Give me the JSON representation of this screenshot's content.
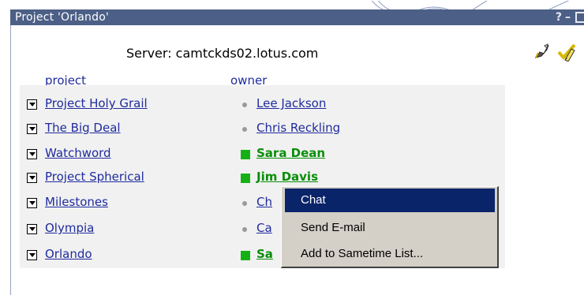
{
  "window": {
    "title": "Project 'Orlando'",
    "controls": [
      "?",
      "–"
    ]
  },
  "header": {
    "server_text": "Server: camtckds02.lotus.com",
    "icons": [
      "rocket-icon",
      "check-pencil-icon"
    ]
  },
  "columns": {
    "project": "project",
    "owner": "owner"
  },
  "rows": [
    {
      "project": "Project Holy Grail",
      "owner": "Lee Jackson",
      "status": "idle"
    },
    {
      "project": "The Big Deal",
      "owner": "Chris Reckling",
      "status": "idle"
    },
    {
      "project": "Watchword",
      "owner": "Sara Dean",
      "status": "active"
    },
    {
      "project": "Project Spherical",
      "owner": "Jim Davis",
      "status": "active"
    },
    {
      "project": "Milestones",
      "owner": "Ch",
      "status": "idle"
    },
    {
      "project": "Olympia",
      "owner": "Ca",
      "status": "idle"
    },
    {
      "project": "Orlando",
      "owner": "Sa",
      "status": "active"
    }
  ],
  "context_menu": {
    "items": [
      "Chat",
      "Send E-mail",
      "Add to Sametime List..."
    ],
    "selected": "Chat"
  },
  "colors": {
    "title_bar": "#4c5f86",
    "link": "#1f2b9e",
    "online": "#14b114",
    "menu_highlight": "#0a246a"
  }
}
